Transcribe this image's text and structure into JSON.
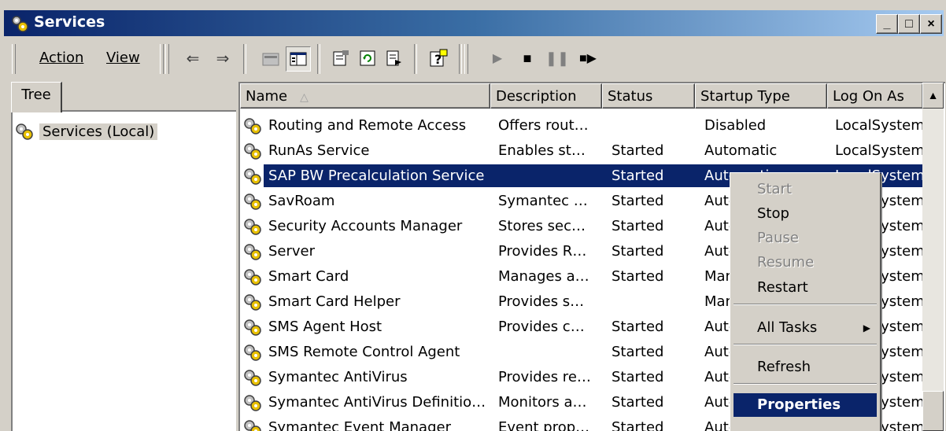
{
  "window": {
    "title": "Services",
    "controls": {
      "minimize": "_",
      "maximize": "□",
      "close": "×"
    }
  },
  "toolbar": {
    "menu_action": "Action",
    "menu_view": "View",
    "icons": [
      "back-icon",
      "forward-icon",
      "up-level-icon",
      "show-hide-tree-icon",
      "properties-icon",
      "refresh-icon",
      "export-list-icon",
      "help-icon",
      "start-service-icon",
      "stop-service-icon",
      "pause-service-icon",
      "restart-service-icon"
    ]
  },
  "tree": {
    "tab_label": "Tree",
    "root_label": "Services (Local)"
  },
  "list": {
    "columns": [
      "Name",
      "Description",
      "Status",
      "Startup Type",
      "Log On As"
    ],
    "sort_column": "Name",
    "rows": [
      {
        "name": "Routing and Remote Access",
        "description": "Offers rout…",
        "status": "",
        "startup": "Disabled",
        "logon": "LocalSystem"
      },
      {
        "name": "RunAs Service",
        "description": "Enables st…",
        "status": "Started",
        "startup": "Automatic",
        "logon": "LocalSystem"
      },
      {
        "name": "SAP BW Precalculation Service",
        "description": "",
        "status": "Started",
        "startup": "Automatic",
        "logon": "LocalSystem",
        "selected": true
      },
      {
        "name": "SavRoam",
        "description": "Symantec …",
        "status": "Started",
        "startup": "Automatic",
        "logon": "LocalSystem"
      },
      {
        "name": "Security Accounts Manager",
        "description": "Stores sec…",
        "status": "Started",
        "startup": "Automatic",
        "logon": "LocalSystem"
      },
      {
        "name": "Server",
        "description": "Provides R…",
        "status": "Started",
        "startup": "Automatic",
        "logon": "LocalSystem"
      },
      {
        "name": "Smart Card",
        "description": "Manages a…",
        "status": "Started",
        "startup": "Manual",
        "logon": "LocalSystem"
      },
      {
        "name": "Smart Card Helper",
        "description": "Provides s…",
        "status": "",
        "startup": "Manual",
        "logon": "LocalSystem"
      },
      {
        "name": "SMS Agent Host",
        "description": "Provides c…",
        "status": "Started",
        "startup": "Automatic",
        "logon": "LocalSystem"
      },
      {
        "name": "SMS Remote Control Agent",
        "description": "",
        "status": "Started",
        "startup": "Automatic",
        "logon": "LocalSystem"
      },
      {
        "name": "Symantec AntiVirus",
        "description": "Provides re…",
        "status": "Started",
        "startup": "Automatic",
        "logon": "LocalSystem"
      },
      {
        "name": "Symantec AntiVirus Definitio…",
        "description": "Monitors a…",
        "status": "Started",
        "startup": "Automatic",
        "logon": "LocalSystem"
      },
      {
        "name": "Symantec Event Manager",
        "description": "Event prop…",
        "status": "Started",
        "startup": "Automatic",
        "logon": "LocalSystem"
      }
    ]
  },
  "context_menu": {
    "items": [
      {
        "label": "Start",
        "enabled": false
      },
      {
        "label": "Stop",
        "enabled": true
      },
      {
        "label": "Pause",
        "enabled": false
      },
      {
        "label": "Resume",
        "enabled": false
      },
      {
        "label": "Restart",
        "enabled": true
      },
      {
        "label": "All Tasks",
        "enabled": true,
        "submenu": true
      },
      {
        "label": "Refresh",
        "enabled": true
      },
      {
        "label": "Properties",
        "enabled": true,
        "highlighted": true
      }
    ]
  },
  "colors": {
    "selection": "#0a246a",
    "face": "#d4d0c8"
  }
}
